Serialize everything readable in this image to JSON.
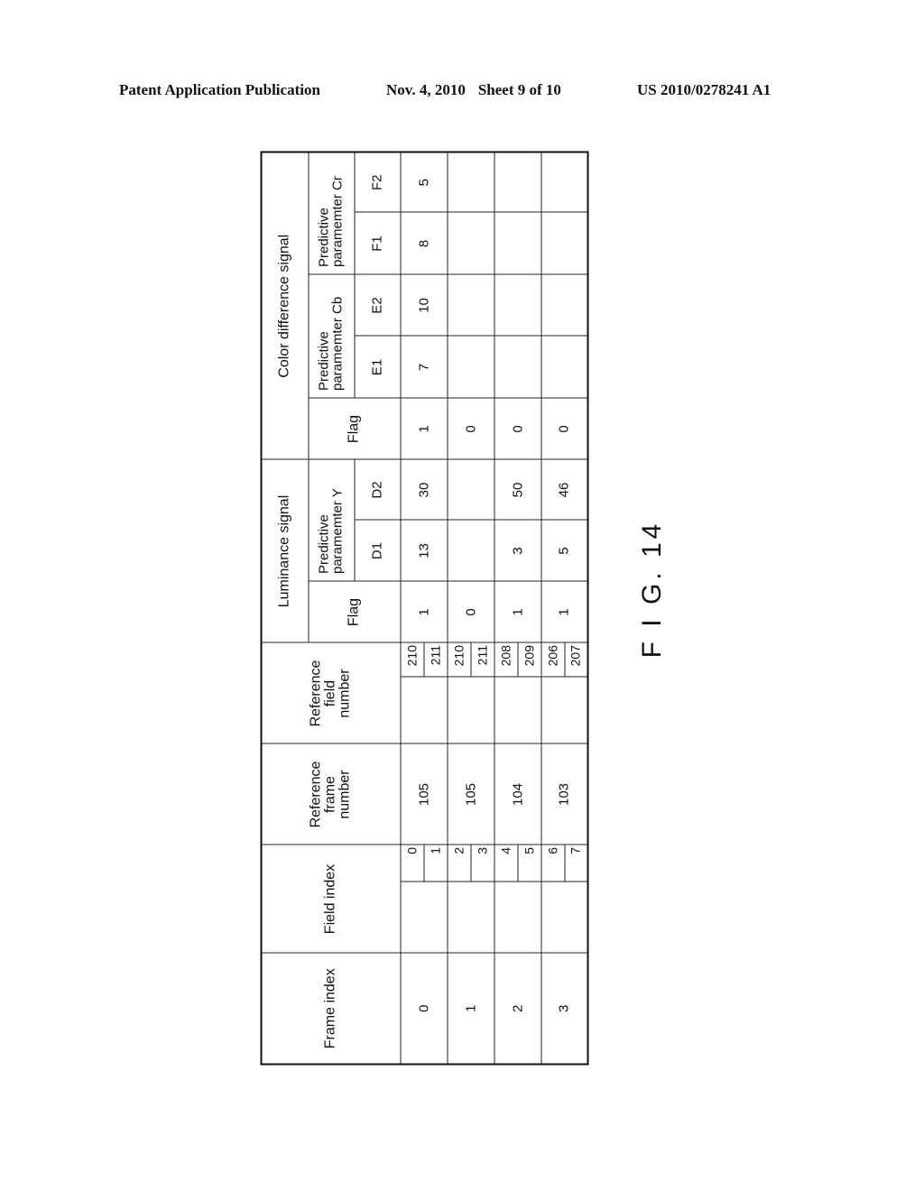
{
  "header": {
    "publication": "Patent Application Publication",
    "date": "Nov. 4, 2010",
    "sheet": "Sheet 9 of 10",
    "patent_number": "US 2010/0278241 A1"
  },
  "figure_label": "F I G. 14",
  "table": {
    "headers": {
      "frame_index": "Frame index",
      "field_index": "Field index",
      "ref_frame": "Reference frame number",
      "ref_field": "Reference field number",
      "luminance_group": "Luminance signal",
      "color_diff_group": "Color difference signal",
      "lum_flag": "Flag",
      "pred_y": "Predictive paramemter  Y",
      "chroma_flag": "Flag",
      "pred_cb": "Predictive paramemter  Cb",
      "pred_cr": "Predictive paramemter  Cr",
      "d1": "D1",
      "d2": "D2",
      "e1": "E1",
      "e2": "E2",
      "f1": "F1",
      "f2": "F2"
    },
    "rows": [
      {
        "frame_index": "0",
        "fields": [
          "0",
          "1"
        ],
        "ref_frame": "105",
        "ref_fields": [
          "210",
          "211"
        ],
        "lum_flag": "1",
        "d1": "13",
        "d2": "30",
        "chroma_flag": "1",
        "e1": "7",
        "e2": "10",
        "f1": "8",
        "f2": "5"
      },
      {
        "frame_index": "1",
        "fields": [
          "2",
          "3"
        ],
        "ref_frame": "105",
        "ref_fields": [
          "210",
          "211"
        ],
        "lum_flag": "0",
        "d1": "",
        "d2": "",
        "chroma_flag": "0",
        "e1": "",
        "e2": "",
        "f1": "",
        "f2": ""
      },
      {
        "frame_index": "2",
        "fields": [
          "4",
          "5"
        ],
        "ref_frame": "104",
        "ref_fields": [
          "208",
          "209"
        ],
        "lum_flag": "1",
        "d1": "3",
        "d2": "50",
        "chroma_flag": "0",
        "e1": "",
        "e2": "",
        "f1": "",
        "f2": ""
      },
      {
        "frame_index": "3",
        "fields": [
          "6",
          "7"
        ],
        "ref_frame": "103",
        "ref_fields": [
          "206",
          "207"
        ],
        "lum_flag": "1",
        "d1": "5",
        "d2": "46",
        "chroma_flag": "0",
        "e1": "",
        "e2": "",
        "f1": "",
        "f2": ""
      }
    ]
  }
}
